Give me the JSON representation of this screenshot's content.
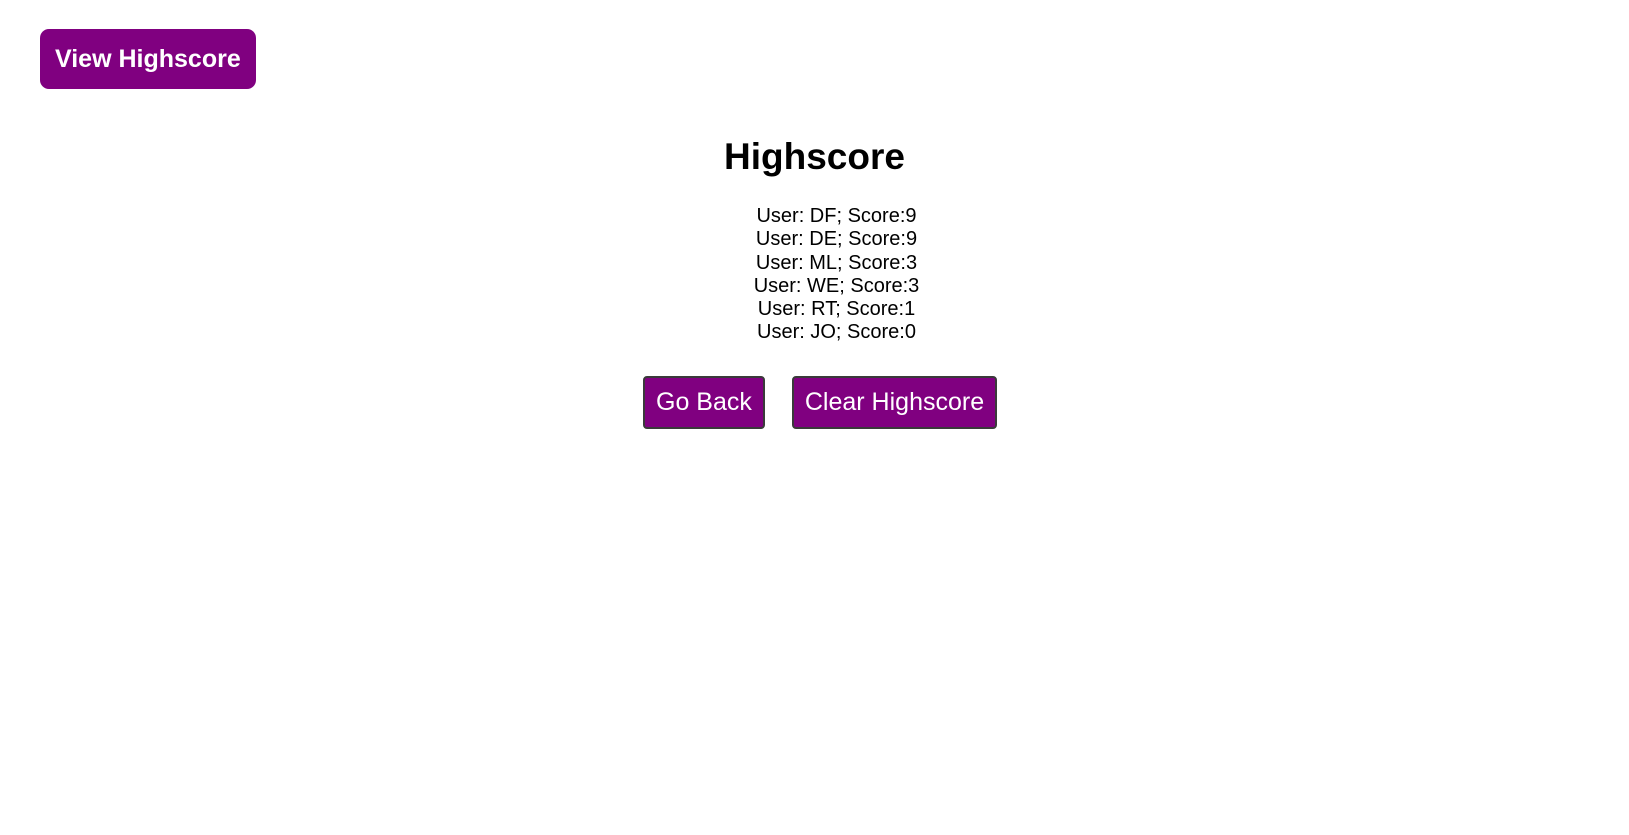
{
  "header": {
    "view_highscore_label": "View Highscore"
  },
  "main": {
    "title": "Highscore",
    "scores": [
      "User: DF; Score:9",
      "User: DE; Score:9",
      "User: ML; Score:3",
      "User: WE; Score:3",
      "User: RT; Score:1",
      "User: JO; Score:0"
    ],
    "go_back_label": "Go Back",
    "clear_highscore_label": "Clear Highscore"
  },
  "colors": {
    "accent": "#800080",
    "background": "#ffffff",
    "text": "#000000"
  }
}
